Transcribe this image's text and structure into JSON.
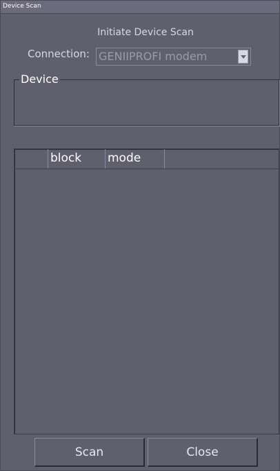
{
  "window": {
    "title": "Device Scan"
  },
  "subtitle": "Initiate Device Scan",
  "connection": {
    "label": "Connection:",
    "value": "GENIIPROFI modem"
  },
  "device_group": {
    "legend": "Device"
  },
  "table": {
    "columns": [
      "",
      "block",
      "mode",
      ""
    ]
  },
  "buttons": {
    "scan": "Scan",
    "close": "Close"
  }
}
